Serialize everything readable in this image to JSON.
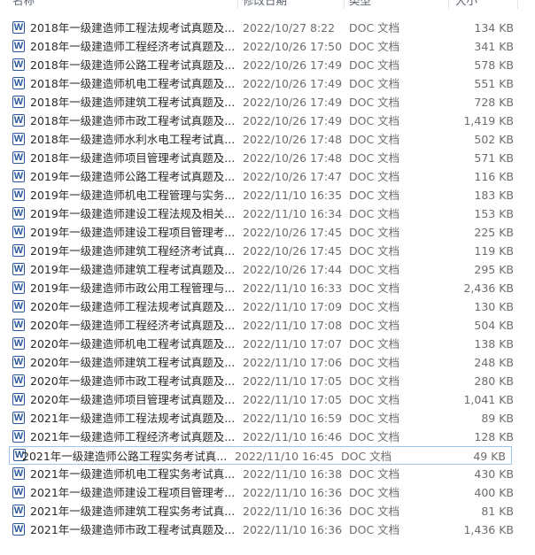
{
  "header": {
    "name": "名称",
    "modified": "修改日期",
    "type": "类型",
    "size": "大小"
  },
  "files": [
    {
      "name": "2018年一级建造师工程法规考试真题及...",
      "date": "2022/10/27 8:22",
      "type": "DOC 文档",
      "size": "134 KB",
      "icon": "word-doc-icon"
    },
    {
      "name": "2018年一级建造师工程经济考试真题及...",
      "date": "2022/10/26 17:50",
      "type": "DOC 文档",
      "size": "341 KB",
      "icon": "word-doc-icon"
    },
    {
      "name": "2018年一级建造师公路工程考试真题及...",
      "date": "2022/10/26 17:49",
      "type": "DOC 文档",
      "size": "578 KB",
      "icon": "word-doc-icon"
    },
    {
      "name": "2018年一级建造师机电工程考试真题及...",
      "date": "2022/10/26 17:49",
      "type": "DOC 文档",
      "size": "551 KB",
      "icon": "word-doc-icon"
    },
    {
      "name": "2018年一级建造师建筑工程考试真题及...",
      "date": "2022/10/26 17:49",
      "type": "DOC 文档",
      "size": "728 KB",
      "icon": "word-doc-icon"
    },
    {
      "name": "2018年一级建造师市政工程考试真题及...",
      "date": "2022/10/26 17:49",
      "type": "DOC 文档",
      "size": "1,419 KB",
      "icon": "word-doc-icon"
    },
    {
      "name": "2018年一级建造师水利水电工程考试真...",
      "date": "2022/10/26 17:48",
      "type": "DOC 文档",
      "size": "502 KB",
      "icon": "word-doc-icon"
    },
    {
      "name": "2018年一级建造师项目管理考试真题及...",
      "date": "2022/10/26 17:48",
      "type": "DOC 文档",
      "size": "571 KB",
      "icon": "word-doc-icon"
    },
    {
      "name": "2019年一级建造师公路工程考试真题及...",
      "date": "2022/10/26 17:47",
      "type": "DOC 文档",
      "size": "116 KB",
      "icon": "word-doc-icon"
    },
    {
      "name": "2019年一级建造师机电工程管理与实务...",
      "date": "2022/11/10 16:35",
      "type": "DOC 文档",
      "size": "183 KB",
      "icon": "word-doc-icon"
    },
    {
      "name": "2019年一级建造师建设工程法规及相关...",
      "date": "2022/11/10 16:34",
      "type": "DOC 文档",
      "size": "153 KB",
      "icon": "word-doc-icon"
    },
    {
      "name": "2019年一级建造师建设工程项目管理考...",
      "date": "2022/10/26 17:45",
      "type": "DOC 文档",
      "size": "225 KB",
      "icon": "word-doc-icon"
    },
    {
      "name": "2019年一级建造师建筑工程经济考试真...",
      "date": "2022/10/26 17:45",
      "type": "DOC 文档",
      "size": "119 KB",
      "icon": "word-doc-icon"
    },
    {
      "name": "2019年一级建造师建筑工程考试真题及...",
      "date": "2022/10/26 17:44",
      "type": "DOC 文档",
      "size": "295 KB",
      "icon": "word-doc-icon"
    },
    {
      "name": "2019年一级建造师市政公用工程管理与...",
      "date": "2022/11/10 16:33",
      "type": "DOC 文档",
      "size": "2,436 KB",
      "icon": "word-doc-icon"
    },
    {
      "name": "2020年一级建造师工程法规考试真题及...",
      "date": "2022/11/10 17:09",
      "type": "DOC 文档",
      "size": "130 KB",
      "icon": "word-doc-icon"
    },
    {
      "name": "2020年一级建造师工程经济考试真题及...",
      "date": "2022/11/10 17:08",
      "type": "DOC 文档",
      "size": "504 KB",
      "icon": "word-doc-icon"
    },
    {
      "name": "2020年一级建造师机电工程考试真题及...",
      "date": "2022/11/10 17:07",
      "type": "DOC 文档",
      "size": "138 KB",
      "icon": "word-doc-icon"
    },
    {
      "name": "2020年一级建造师建筑工程考试真题及...",
      "date": "2022/11/10 17:06",
      "type": "DOC 文档",
      "size": "248 KB",
      "icon": "word-doc-icon"
    },
    {
      "name": "2020年一级建造师市政工程考试真题及...",
      "date": "2022/11/10 17:05",
      "type": "DOC 文档",
      "size": "280 KB",
      "icon": "word-doc-icon"
    },
    {
      "name": "2020年一级建造师项目管理考试真题及...",
      "date": "2022/11/10 17:05",
      "type": "DOC 文档",
      "size": "1,041 KB",
      "icon": "word-doc-icon"
    },
    {
      "name": "2021年一级建造师工程法规考试真题及...",
      "date": "2022/11/10 16:59",
      "type": "DOC 文档",
      "size": "89 KB",
      "icon": "word-doc-icon"
    },
    {
      "name": "2021年一级建造师工程经济考试真题及...",
      "date": "2022/11/10 16:46",
      "type": "DOC 文档",
      "size": "128 KB",
      "icon": "word-doc-icon"
    },
    {
      "name": "2021年一级建造师公路工程实务考试真...",
      "date": "2022/11/10 16:45",
      "type": "DOC 文档",
      "size": "49 KB",
      "icon": "word-doc-icon",
      "selected": true
    },
    {
      "name": "2021年一级建造师机电工程实务考试真...",
      "date": "2022/11/10 16:38",
      "type": "DOC 文档",
      "size": "430 KB",
      "icon": "word-doc-icon"
    },
    {
      "name": "2021年一级建造师建设工程项目管理考...",
      "date": "2022/11/10 16:36",
      "type": "DOC 文档",
      "size": "400 KB",
      "icon": "word-doc-icon"
    },
    {
      "name": "2021年一级建造师建筑工程实务考试真...",
      "date": "2022/11/10 16:36",
      "type": "DOC 文档",
      "size": "81 KB",
      "icon": "word-doc-icon"
    },
    {
      "name": "2021年一级建造师市政工程考试真题及...",
      "date": "2022/11/10 16:36",
      "type": "DOC 文档",
      "size": "1,436 KB",
      "icon": "word-doc-icon"
    }
  ],
  "colors": {
    "icon_blue": "#2b579a",
    "selection_border": "#9ec5ea",
    "header_text": "#5b6270"
  }
}
